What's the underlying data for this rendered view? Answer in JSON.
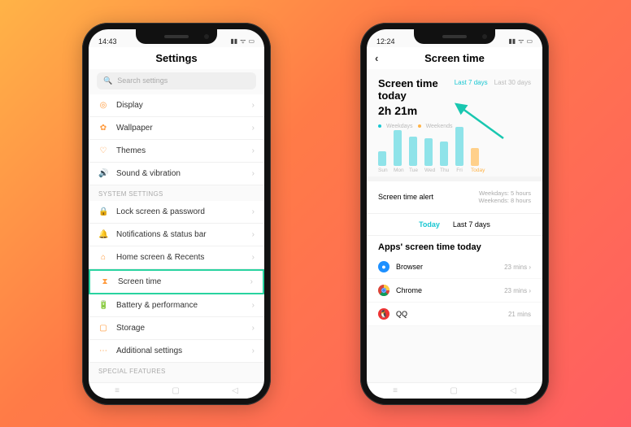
{
  "phone1": {
    "time": "14:43",
    "title": "Settings",
    "search_placeholder": "Search settings",
    "rows_top": [
      {
        "icon": "◎",
        "label": "Display"
      },
      {
        "icon": "✿",
        "label": "Wallpaper"
      },
      {
        "icon": "♡",
        "label": "Themes"
      },
      {
        "icon": "🔊",
        "label": "Sound & vibration"
      }
    ],
    "section_label": "SYSTEM SETTINGS",
    "rows_sys": [
      {
        "icon": "🔒",
        "label": "Lock screen & password"
      },
      {
        "icon": "🔔",
        "label": "Notifications & status bar"
      },
      {
        "icon": "⌂",
        "label": "Home screen & Recents"
      },
      {
        "icon": "⧗",
        "label": "Screen time",
        "highlight": true
      },
      {
        "icon": "🔋",
        "label": "Battery & performance"
      },
      {
        "icon": "▢",
        "label": "Storage"
      },
      {
        "icon": "⋯",
        "label": "Additional settings"
      }
    ],
    "section_label2": "SPECIAL FEATURES"
  },
  "phone2": {
    "time": "12:24",
    "title": "Screen  time",
    "heading_line1": "Screen time",
    "heading_line2": "today",
    "value": "2h 21m",
    "range_tabs": {
      "active": "Last 7 days",
      "other": "Last 30 days"
    },
    "legend": {
      "a": "Weekdays",
      "b": "Weekends"
    },
    "alerts": {
      "label": "Screen time alert",
      "line1": "Weekdays: 5 hours",
      "line2": "Weekends: 8 hours"
    },
    "tabs": {
      "active": "Today",
      "other": "Last 7 days"
    },
    "apps_header": "Apps' screen time today",
    "apps": [
      {
        "name": "Browser",
        "time": "23 mins",
        "color": "#1E90FF",
        "glyph": "●"
      },
      {
        "name": "Chrome",
        "time": "23 mins",
        "color": "#fff",
        "glyph": ""
      },
      {
        "name": "QQ",
        "time": "21 mins",
        "color": "#e33",
        "glyph": "🐧"
      }
    ]
  },
  "chart_data": {
    "type": "bar",
    "categories": [
      "Sun",
      "Mon",
      "Tue",
      "Wed",
      "Thu",
      "Fri",
      "Today"
    ],
    "values": [
      18,
      44,
      36,
      34,
      30,
      48,
      22
    ],
    "series_type": [
      "weekend",
      "weekday",
      "weekday",
      "weekday",
      "weekday",
      "weekday",
      "today"
    ],
    "colors": {
      "weekday": "#8fe3e9",
      "weekend": "#8fe3e9",
      "today": "#ffd08a"
    },
    "ylim": [
      0,
      54
    ],
    "title": "Screen time today",
    "xlabel": "",
    "ylabel": ""
  }
}
